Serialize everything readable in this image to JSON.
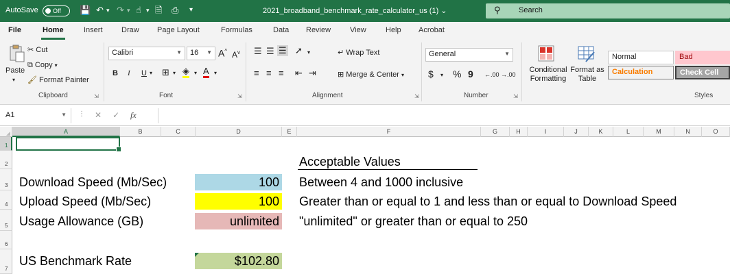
{
  "titlebar": {
    "autosave_label": "AutoSave",
    "autosave_state": "Off",
    "filename": "2021_broadband_benchmark_rate_calculator_us (1)",
    "filename_arrow": "⌄",
    "search_placeholder": "Search",
    "colors": {
      "bar": "#217346",
      "search": "#a8d5b8"
    }
  },
  "tabs": [
    "File",
    "Home",
    "Insert",
    "Draw",
    "Page Layout",
    "Formulas",
    "Data",
    "Review",
    "View",
    "Help",
    "Acrobat"
  ],
  "active_tab": "Home",
  "ribbon": {
    "clipboard": {
      "paste": "Paste",
      "cut": "Cut",
      "copy": "Copy",
      "format_painter": "Format Painter",
      "group": "Clipboard"
    },
    "font": {
      "name": "Calibri",
      "size": "16",
      "bold": "B",
      "italic": "I",
      "underline": "U",
      "group": "Font",
      "grow": "A",
      "shrink": "A"
    },
    "alignment": {
      "wrap_text": "Wrap Text",
      "merge_center": "Merge & Center",
      "group": "Alignment"
    },
    "number": {
      "format": "General",
      "currency": "$",
      "percent": "%",
      "comma": "9",
      "inc_decimal": ".00",
      "dec_decimal": ".00",
      "group": "Number"
    },
    "styles": {
      "conditional_formatting": "Conditional\nFormatting",
      "format_as_table": "Format as\nTable",
      "normal": "Normal",
      "bad": "Bad",
      "calculation": "Calculation",
      "check_cell": "Check Cell",
      "group": "Styles"
    }
  },
  "formula_bar": {
    "name_box": "A1",
    "fx": "fx",
    "value": ""
  },
  "grid": {
    "columns": [
      "A",
      "B",
      "C",
      "D",
      "E",
      "F",
      "G",
      "H",
      "I",
      "J",
      "K",
      "L",
      "M",
      "N",
      "O"
    ],
    "rows": [
      "1",
      "2",
      "3",
      "4",
      "5",
      "6",
      "7"
    ],
    "selected_cell": "A1",
    "cells": {
      "F2": "Acceptable Values",
      "A3": "Download Speed (Mb/Sec)",
      "D3": "100",
      "F3": "Between 4 and 1000 inclusive",
      "A4": "Upload Speed (Mb/Sec)",
      "D4": "100",
      "F4": "Greater than or equal to 1 and less than or equal to Download Speed",
      "A5": "Usage Allowance (GB)",
      "D5": "unlimited",
      "F5": "\"unlimited\" or greater than or equal to 250",
      "A7": "US Benchmark Rate",
      "D7": "$102.80"
    },
    "cell_colors": {
      "D3": "#add8e6",
      "D4": "#ffff00",
      "D5": "#e6b8b7",
      "D7": "#c4d79b"
    }
  }
}
